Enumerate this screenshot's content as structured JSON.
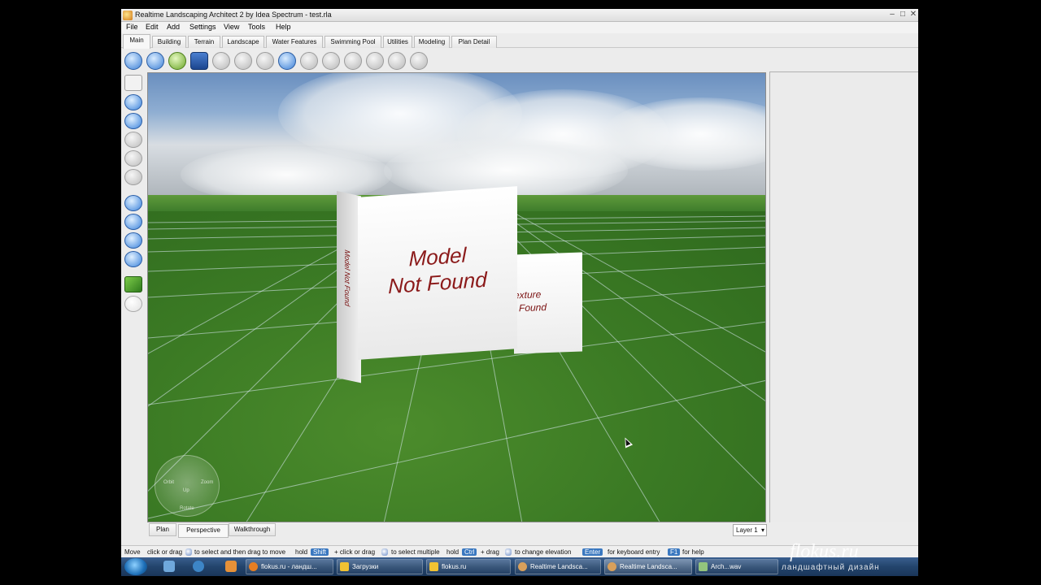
{
  "window": {
    "title": "Realtime Landscaping Architect 2 by Idea Spectrum - test.rla",
    "minimize": "–",
    "maximize": "□",
    "close": "✕"
  },
  "menu": [
    "File",
    "Edit",
    "Add",
    "Settings",
    "View",
    "Tools",
    "Help"
  ],
  "tabs": [
    "Main",
    "Building",
    "Terrain",
    "Landscape",
    "Water Features",
    "Swimming Pool",
    "Utilities",
    "Modeling",
    "Plan Detail"
  ],
  "active_tab": "Main",
  "toolbar_icons": [
    "line-draw-icon",
    "curve-draw-icon",
    "open-folder-icon",
    "save-icon",
    "cut-icon",
    "copy-icon",
    "paste-icon",
    "paint-icon",
    "stamp-icon",
    "table-icon",
    "fence-icon",
    "shape-1-icon",
    "shape-2-icon",
    "shape-3-icon"
  ],
  "left_tools": [
    "select-arrow-icon",
    "rotate-view-icon",
    "pan-view-icon",
    "tool-a-icon",
    "tool-b-icon",
    "tool-c-icon",
    "hand-icon",
    "zoom-icon",
    "zoom-extents-icon",
    "orbit-icon",
    "grass-icon",
    "magnet-icon"
  ],
  "viewport": {
    "model_text_line1": "Model",
    "model_text_line2": "Not Found",
    "side_text": "Model Not Found",
    "texture_text_line1": "exture",
    "texture_text_line2": "Found",
    "compass": {
      "n": "Orbit",
      "e": "Zoom",
      "w": "Orbit",
      "s": "Rotate",
      "c": "Up"
    }
  },
  "view_tabs": [
    "Plan",
    "Perspective",
    "Walkthrough"
  ],
  "active_view": "Perspective",
  "layer": "Layer 1",
  "status": {
    "mode": "Move",
    "t1": "click or drag",
    "t2": "to select and then drag to move",
    "t3": "hold",
    "k1": "Shift",
    "t4": "+ click or drag",
    "t5": "to select multiple",
    "t6": "hold",
    "k2": "Ctrl",
    "t7": "+ drag",
    "t8": "to change elevation",
    "k3": "Enter",
    "t9": "for keyboard entry",
    "k4": "F1",
    "t10": "for help"
  },
  "taskbar": [
    "flokus.ru - ландш...",
    "Загрузки",
    "flokus.ru",
    "Realtime Landsca...",
    "Realtime Landsca...",
    "Arch...wav"
  ],
  "watermark": {
    "line1": "flokus.ru",
    "line2": "ландшафтный дизайн"
  },
  "colors": {
    "model_text": "#8b1a1a",
    "taskbar": "#23446c",
    "key_badge": "#3a78c0"
  }
}
